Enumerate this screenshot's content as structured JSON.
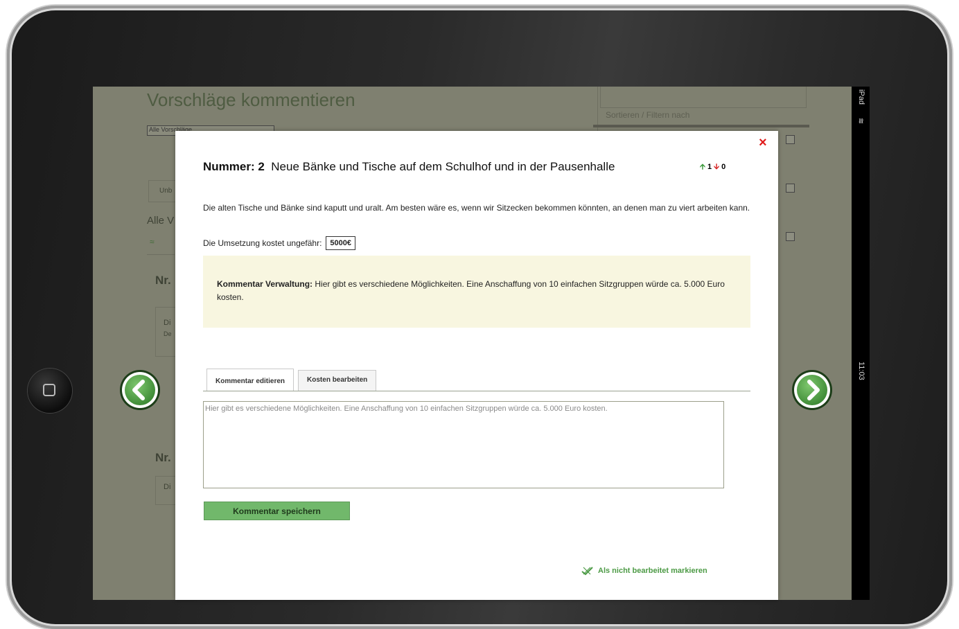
{
  "background": {
    "title": "Vorschläge kommentieren",
    "select_value": "Alle Vorschläge",
    "sort_label": "Sortieren / Filtern nach",
    "tab_label_partial": "Unb",
    "section_partial": "Alle V",
    "item1_partial": "Nr.",
    "item2_partial": "Nr.",
    "item1_line1": "Di",
    "item1_line2": "De",
    "item2_line1": "Di"
  },
  "statusbar": {
    "device": "iPad",
    "wifi_icon": "wifi-icon",
    "time": "11:03"
  },
  "modal": {
    "number_label": "Nummer: 2",
    "title": "Neue Bänke und Tische auf dem Schulhof und in der Pausenhalle",
    "votes_up": "1",
    "votes_down": "0",
    "description": "Die alten Tische und Bänke sind kaputt und uralt. Am besten wäre es, wenn wir Sitzecken bekommen könnten, an denen man zu viert arbeiten kann.",
    "cost_label": "Die Umsetzung kostet ungefähr:",
    "cost_value": "5000€",
    "note_label": "Kommentar Verwaltung:",
    "note_text": "Hier gibt es verschiedene Möglichkeiten. Eine Anschaffung von 10 einfachen Sitzgruppen würde ca. 5.000 Euro kosten.",
    "tabs": [
      {
        "label": "Kommentar editieren"
      },
      {
        "label": "Kosten bearbeiten"
      }
    ],
    "textarea_value": "Hier gibt es verschiedene Möglichkeiten. Eine Anschaffung von 10 einfachen Sitzgruppen würde ca. 5.000 Euro kosten.",
    "save_button": "Kommentar speichern",
    "mark_link": "Als nicht bearbeitet markieren",
    "close": "×"
  },
  "colors": {
    "accent_green": "#71b86b",
    "close_red": "#e01b1b",
    "note_bg": "#f8f6e0"
  }
}
